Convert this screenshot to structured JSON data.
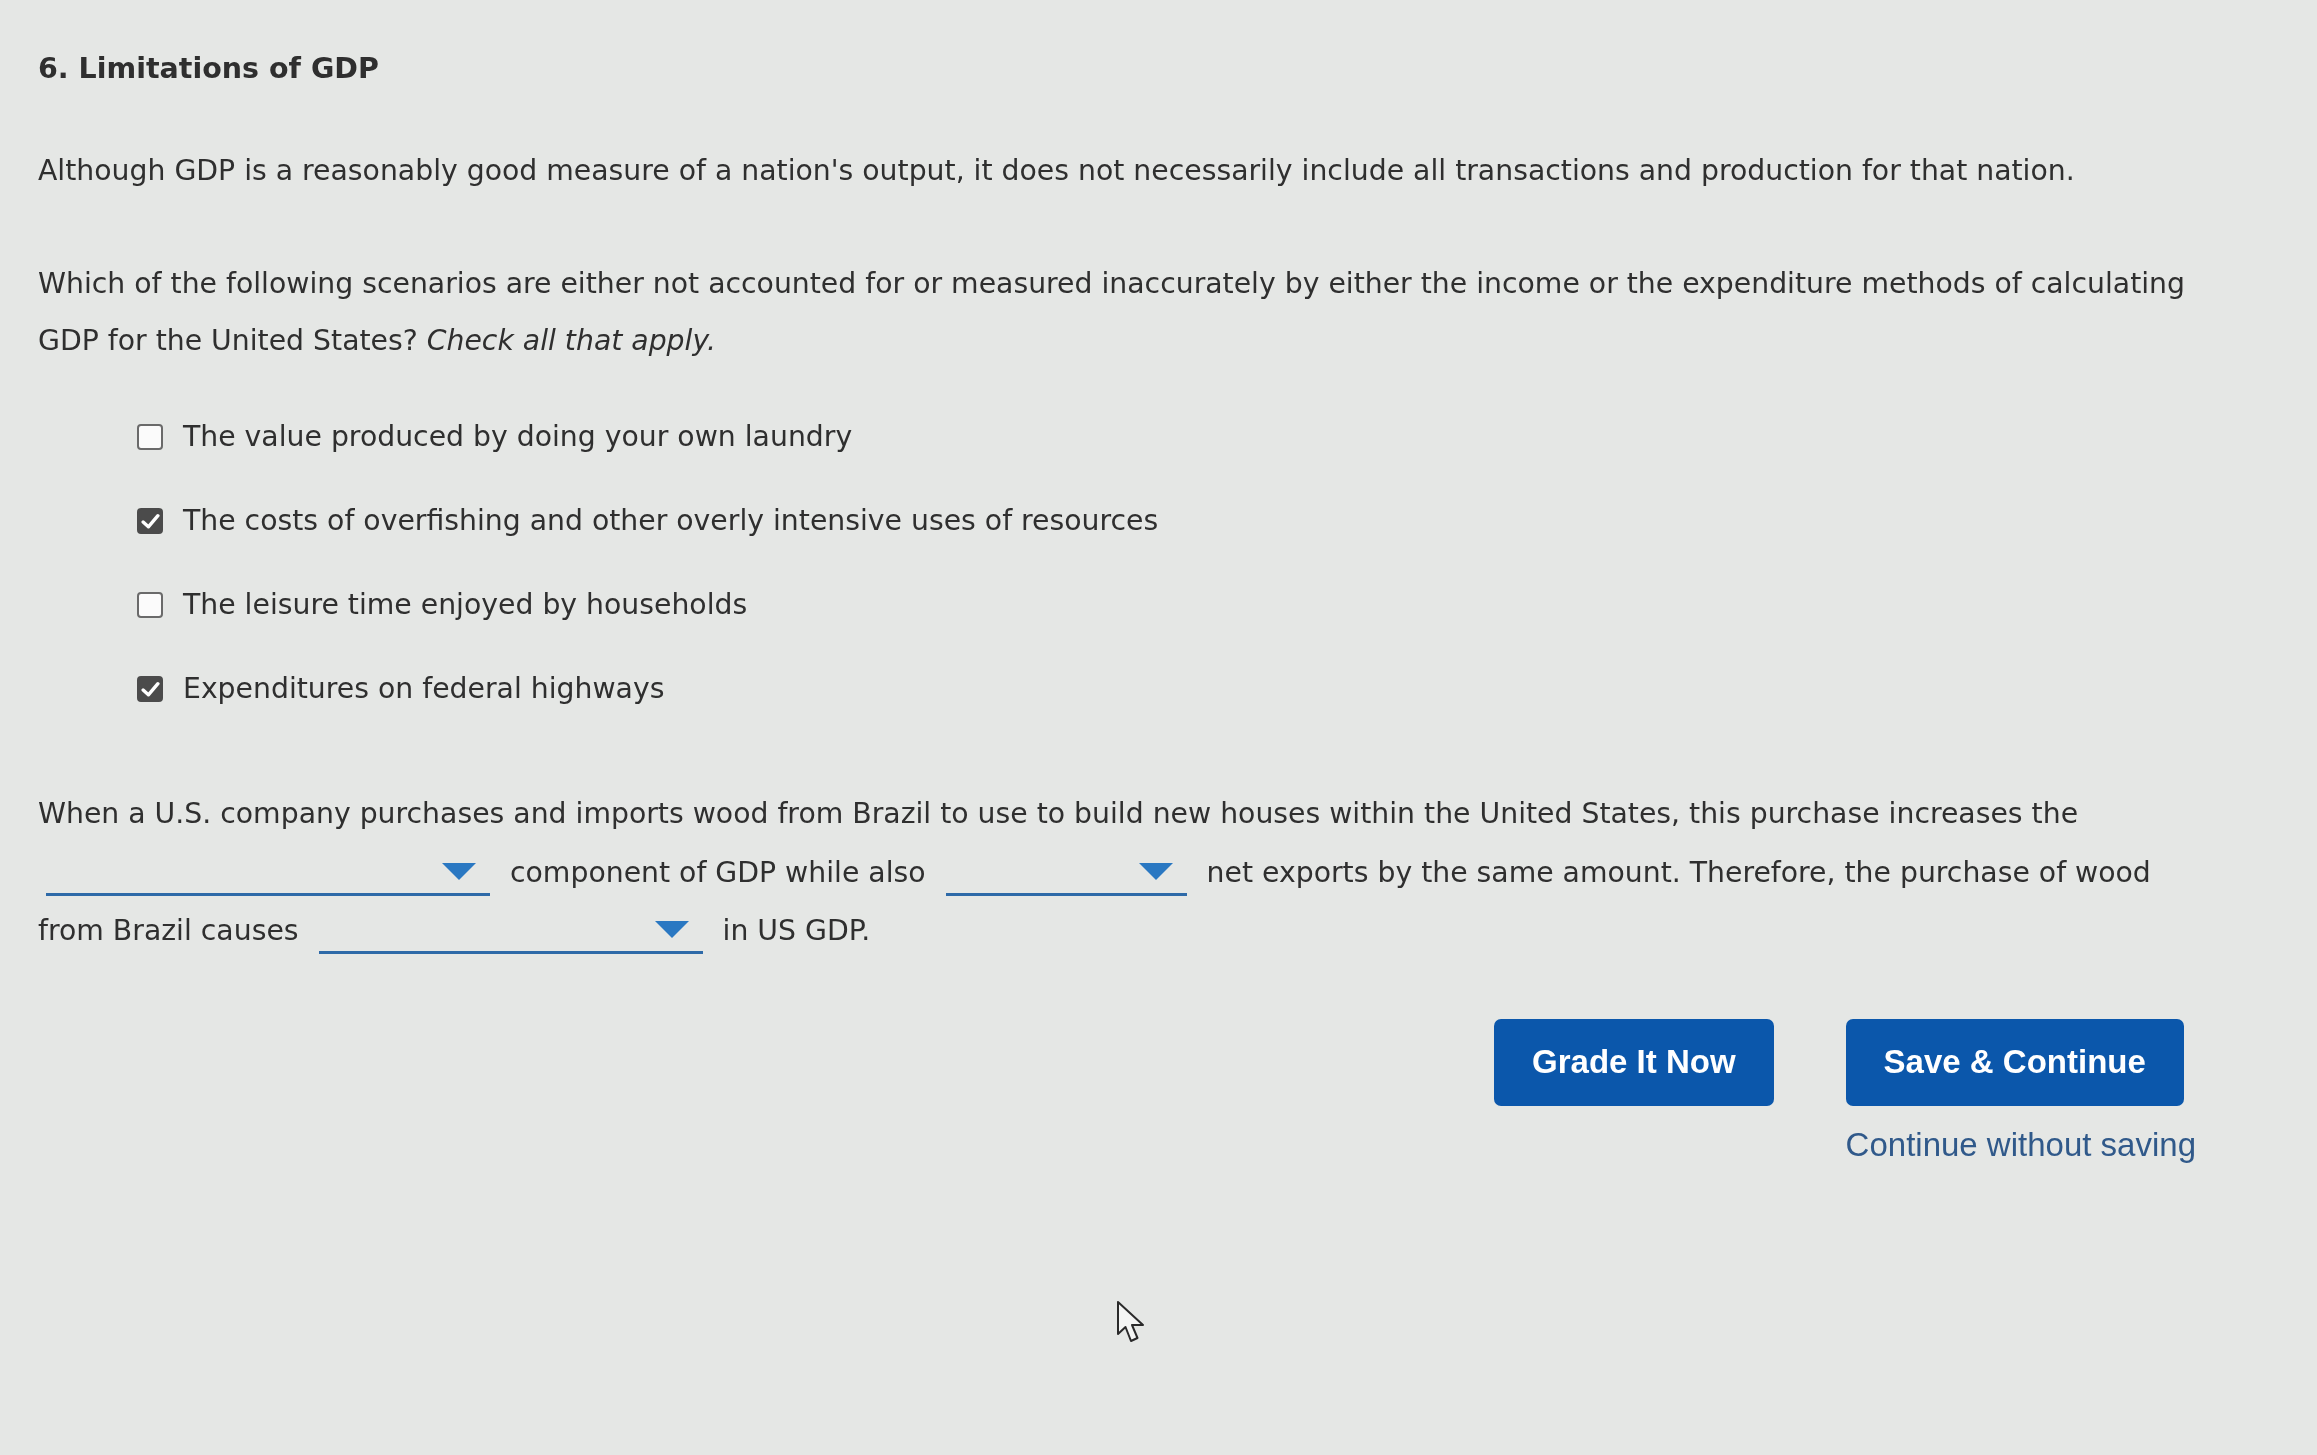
{
  "question": {
    "title": "6. Limitations of GDP",
    "intro": "Although GDP is a reasonably good measure of a nation's output, it does not necessarily include all transactions and production for that nation.",
    "prompt": "Which of the following scenarios are either not accounted for or measured inaccurately by either the income or the expenditure methods of calculating GDP for the United States? *Check all that apply.*",
    "options": [
      {
        "label": "The value produced by doing your own laundry",
        "checked": false
      },
      {
        "label": "The costs of overfishing and other overly intensive uses of resources",
        "checked": true
      },
      {
        "label": "The leisure time enjoyed by households",
        "checked": false
      },
      {
        "label": "Expenditures on federal highways",
        "checked": true
      }
    ]
  },
  "fill_in": {
    "lines": [
      {
        "parts": [
          {
            "kind": "text",
            "text": "When a U.S. company purchases and imports wood from Brazil to use to build new houses within the United States, this purchase increases the"
          }
        ]
      },
      {
        "parts": [
          {
            "kind": "dropdown"
          },
          {
            "kind": "text",
            "text": "component of GDP while also"
          },
          {
            "kind": "dropdown"
          },
          {
            "kind": "text",
            "text": "net exports by the same amount. Therefore, the purchase of wood"
          }
        ]
      },
      {
        "parts": [
          {
            "kind": "text",
            "text": "from Brazil causes"
          },
          {
            "kind": "dropdown"
          },
          {
            "kind": "text",
            "text": "in US GDP."
          }
        ]
      }
    ]
  },
  "actions": {
    "buttons": [
      {
        "label": "Grade It Now"
      },
      {
        "label": "Save & Continue"
      }
    ],
    "link": "Continue without saving"
  }
}
